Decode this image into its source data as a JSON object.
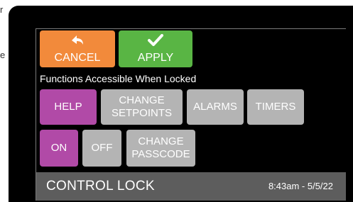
{
  "background": {
    "left_fragment_top": "r",
    "left_fragment_mid": "e"
  },
  "toolbar": {
    "cancel_label": "CANCEL",
    "apply_label": "APPLY",
    "cancel_icon": "undo-arrow-icon",
    "apply_icon": "checkmark-icon"
  },
  "section": {
    "title": "Functions Accessible When Locked"
  },
  "functions": {
    "help": "HELP",
    "change_setpoints_line1": "CHANGE",
    "change_setpoints_line2": "SETPOINTS",
    "alarms": "ALARMS",
    "timers": "TIMERS",
    "on": "ON",
    "off": "OFF",
    "change_passcode_line1": "CHANGE",
    "change_passcode_line2": "PASSCODE"
  },
  "status_bar": {
    "title": "CONTROL LOCK",
    "timestamp": "8:43am - 5/5/22"
  },
  "colors": {
    "cancel": "#f28a3b",
    "apply": "#59b544",
    "selected": "#b14aa7",
    "unselected": "#b4b4b4",
    "status_bar": "#5d5d5d"
  }
}
